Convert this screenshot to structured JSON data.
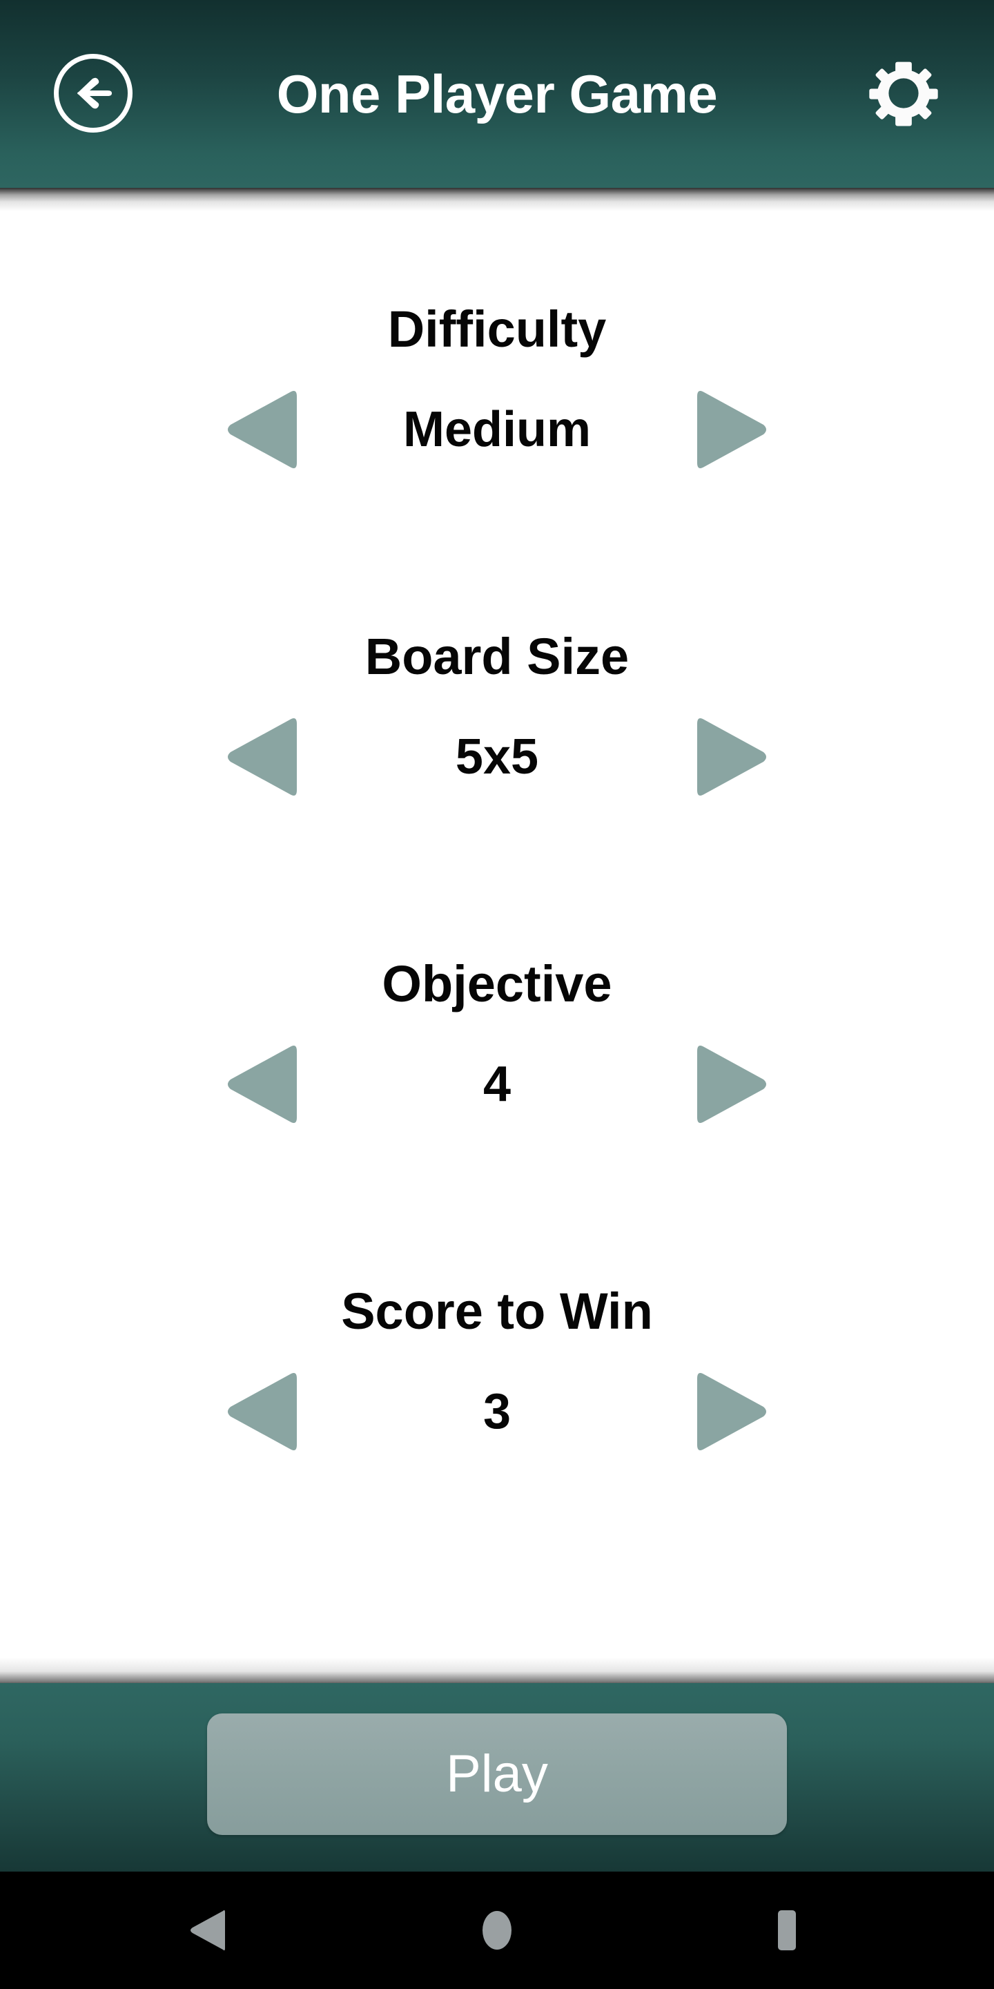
{
  "header": {
    "title": "One Player Game",
    "back_icon": "arrow-left-circle-icon",
    "settings_icon": "gear-icon",
    "background_color": "#2a615c"
  },
  "settings": [
    {
      "label": "Difficulty",
      "value": "Medium",
      "prev_icon": "triangle-left-icon",
      "next_icon": "triangle-right-icon"
    },
    {
      "label": "Board Size",
      "value": "5x5",
      "prev_icon": "triangle-left-icon",
      "next_icon": "triangle-right-icon"
    },
    {
      "label": "Objective",
      "value": "4",
      "prev_icon": "triangle-left-icon",
      "next_icon": "triangle-right-icon"
    },
    {
      "label": "Score to Win",
      "value": "3",
      "prev_icon": "triangle-left-icon",
      "next_icon": "triangle-right-icon"
    }
  ],
  "footer": {
    "play_label": "Play",
    "button_color": "#90a5a4"
  },
  "navbar": {
    "back_icon": "nav-back-triangle-icon",
    "home_icon": "nav-home-circle-icon",
    "recents_icon": "nav-recents-square-icon"
  },
  "colors": {
    "arrow": "#8aa5a2",
    "header_dark": "#12302f",
    "header_light": "#2e6661",
    "text": "#060606"
  }
}
